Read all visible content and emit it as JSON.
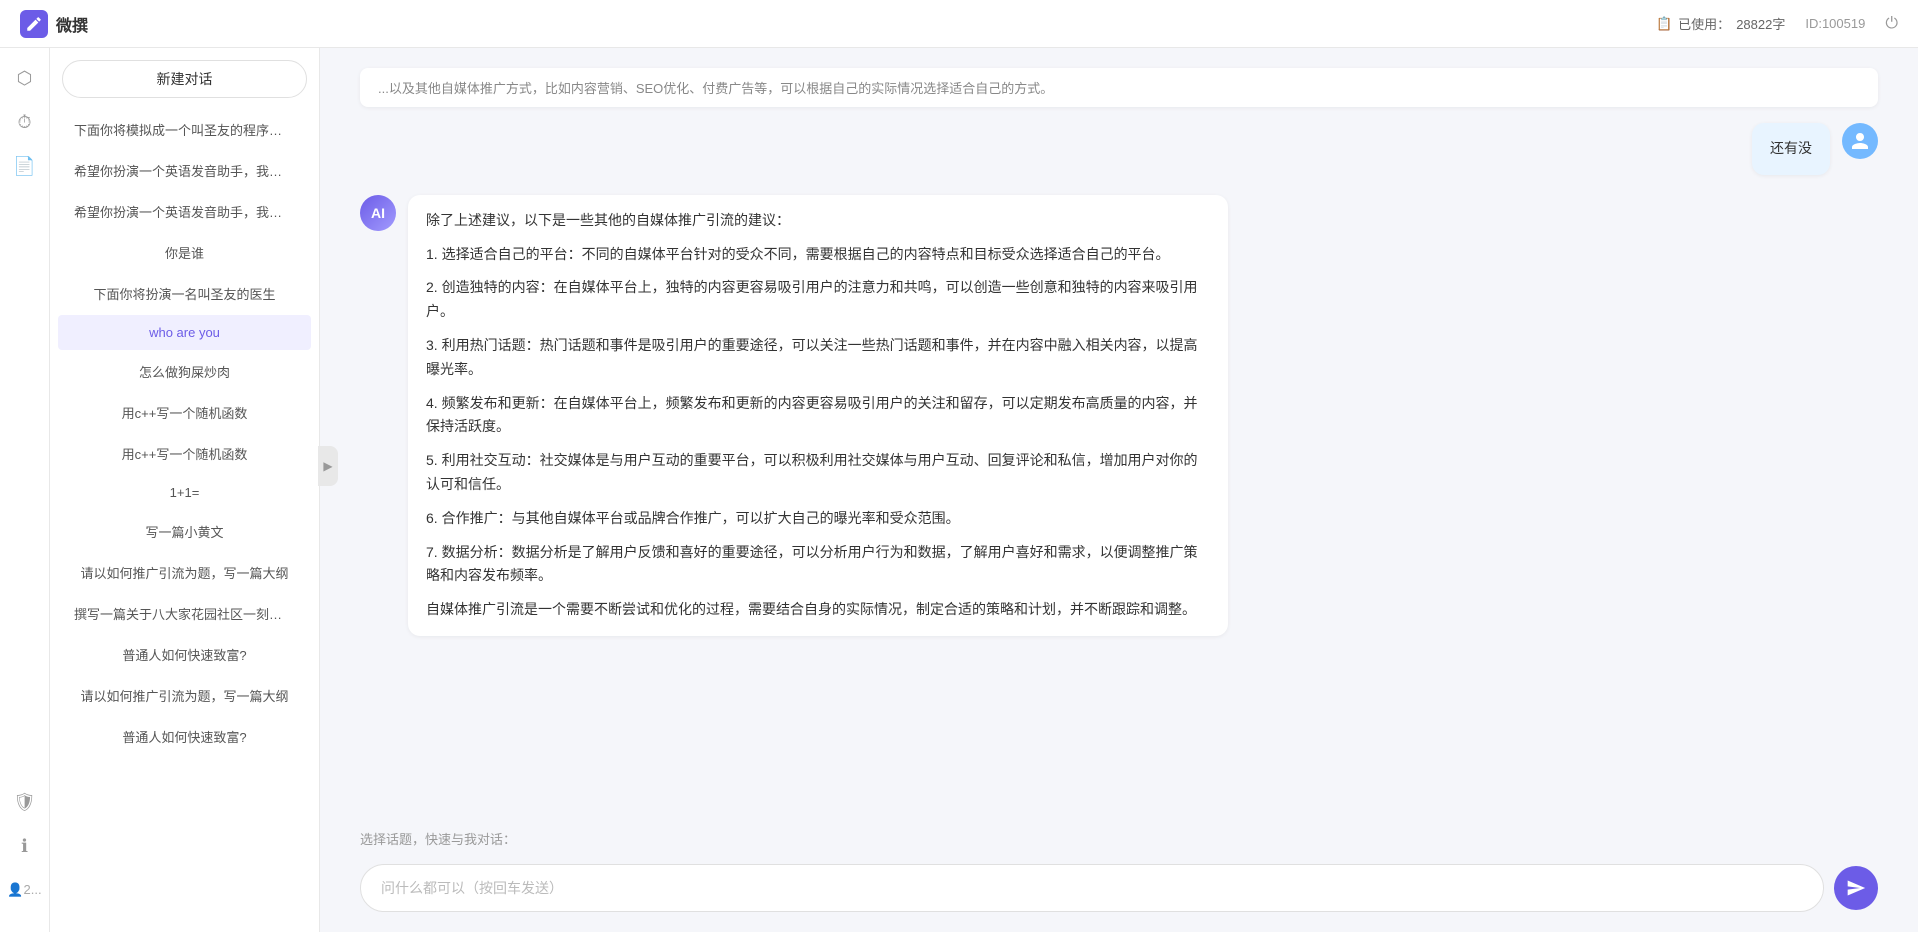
{
  "app": {
    "title": "微撰",
    "usage_label": "已使用：",
    "usage_value": "28822字",
    "id_label": "ID:100519"
  },
  "topbar": {
    "storage_icon": "📋",
    "power_label": "⏻"
  },
  "sidebar_icons": [
    {
      "name": "hexagon-icon",
      "glyph": "⬡"
    },
    {
      "name": "clock-icon",
      "glyph": "⏱"
    },
    {
      "name": "document-icon",
      "glyph": "📄"
    },
    {
      "name": "shield-icon",
      "glyph": "🛡"
    },
    {
      "name": "info-icon",
      "glyph": "ℹ"
    },
    {
      "name": "user-icon",
      "glyph": "👤"
    }
  ],
  "conversations": {
    "new_button": "新建对话",
    "items": [
      {
        "id": 1,
        "text": "下面你将模拟成一个叫圣友的程序员，我说..."
      },
      {
        "id": 2,
        "text": "希望你扮演一个英语发音助手，我提供给你..."
      },
      {
        "id": 3,
        "text": "希望你扮演一个英语发音助手，我提供给你..."
      },
      {
        "id": 4,
        "text": "你是谁"
      },
      {
        "id": 5,
        "text": "下面你将扮演一名叫圣友的医生"
      },
      {
        "id": 6,
        "text": "who are you",
        "active": true
      },
      {
        "id": 7,
        "text": "怎么做狗屎炒肉"
      },
      {
        "id": 8,
        "text": "用c++写一个随机函数"
      },
      {
        "id": 9,
        "text": "用c++写一个随机函数"
      },
      {
        "id": 10,
        "text": "1+1="
      },
      {
        "id": 11,
        "text": "写一篇小黄文"
      },
      {
        "id": 12,
        "text": "请以如何推广引流为题，写一篇大纲"
      },
      {
        "id": 13,
        "text": "撰写一篇关于八大家花园社区一刻钟便民生..."
      },
      {
        "id": 14,
        "text": "普通人如何快速致富?"
      },
      {
        "id": 15,
        "text": "请以如何推广引流为题，写一篇大纲"
      },
      {
        "id": 16,
        "text": "普通人如何快速致富?"
      }
    ]
  },
  "collapse_icon": "▶",
  "chat": {
    "partial_top": "...以及其他自媒体推广方式，比如内容营销、SEO优化、付费广告等，可以根据自己的实际情况选择适合自己的方式。",
    "messages": [
      {
        "role": "user",
        "avatar_type": "user",
        "content": "还有没"
      },
      {
        "role": "ai",
        "avatar_type": "ai",
        "content_paragraphs": [
          "除了上述建议，以下是一些其他的自媒体推广引流的建议：",
          "1. 选择适合自己的平台：不同的自媒体平台针对的受众不同，需要根据自己的内容特点和目标受众选择适合自己的平台。",
          "2. 创造独特的内容：在自媒体平台上，独特的内容更容易吸引用户的注意力和共鸣，可以创造一些创意和独特的内容来吸引用户。",
          "3. 利用热门话题：热门话题和事件是吸引用户的重要途径，可以关注一些热门话题和事件，并在内容中融入相关内容，以提高曝光率。",
          "4. 频繁发布和更新：在自媒体平台上，频繁发布和更新的内容更容易吸引用户的关注和留存，可以定期发布高质量的内容，并保持活跃度。",
          "5. 利用社交互动：社交媒体是与用户互动的重要平台，可以积极利用社交媒体与用户互动、回复评论和私信，增加用户对你的认可和信任。",
          "6. 合作推广：与其他自媒体平台或品牌合作推广，可以扩大自己的曝光率和受众范围。",
          "7. 数据分析：数据分析是了解用户反馈和喜好的重要途径，可以分析用户行为和数据，了解用户喜好和需求，以便调整推广策略和内容发布频率。",
          "自媒体推广引流是一个需要不断尝试和优化的过程，需要结合自身的实际情况，制定合适的策略和计划，并不断跟踪和调整。"
        ]
      }
    ]
  },
  "quick_prompts": {
    "label": "选择话题，快速与我对话：",
    "chips": []
  },
  "input": {
    "placeholder": "问什么都可以（按回车发送）"
  }
}
